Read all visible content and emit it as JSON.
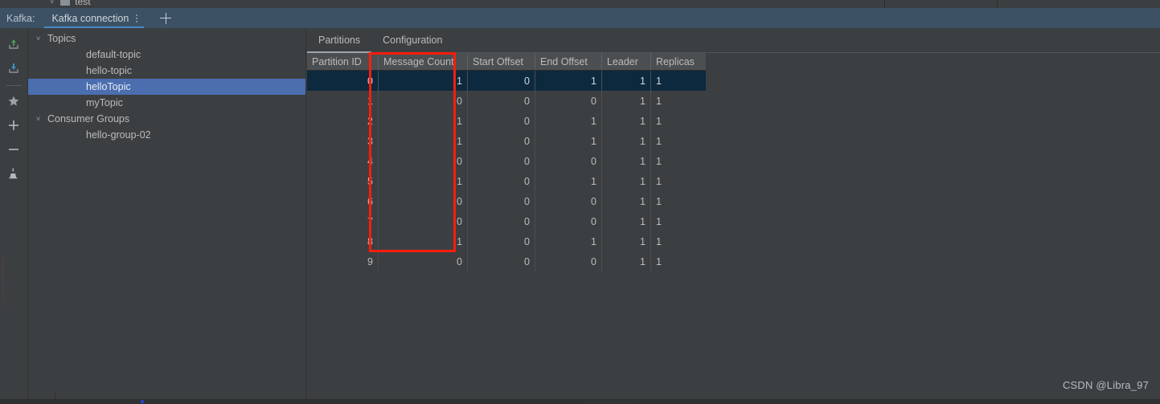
{
  "top_strip": {
    "label": "test",
    "chevron_icon": "chevron-down-icon",
    "folder_icon": "folder-icon"
  },
  "tabbar": {
    "prefix": "Kafka:",
    "tabs": [
      {
        "label": "Kafka connection",
        "active": true,
        "menu_icon": "more-vertical-icon"
      }
    ],
    "add_label": "+",
    "add_icon": "plus-icon",
    "background": "#3c5264",
    "active_underline": "#4a88c7"
  },
  "rail": {
    "buttons": [
      {
        "name": "import-icon",
        "title": "Import"
      },
      {
        "name": "export-icon",
        "title": "Export"
      },
      {
        "name": "favorite-star-icon",
        "title": "Favorite"
      },
      {
        "name": "add-icon",
        "title": "Add"
      },
      {
        "name": "remove-icon",
        "title": "Remove"
      },
      {
        "name": "data-source-icon",
        "title": "Data Source"
      }
    ]
  },
  "tree": {
    "rows": [
      {
        "label": "Topics",
        "level": 0,
        "expanded": true,
        "chevron": "˅",
        "selected": false
      },
      {
        "label": "default-topic",
        "level": 1,
        "expanded": false,
        "chevron": "",
        "selected": false
      },
      {
        "label": "hello-topic",
        "level": 1,
        "expanded": false,
        "chevron": "",
        "selected": false
      },
      {
        "label": "helloTopic",
        "level": 1,
        "expanded": false,
        "chevron": "",
        "selected": true
      },
      {
        "label": "myTopic",
        "level": 1,
        "expanded": false,
        "chevron": "",
        "selected": false
      },
      {
        "label": "Consumer Groups",
        "level": 0,
        "expanded": true,
        "chevron": "˅",
        "selected": false
      },
      {
        "label": "hello-group-02",
        "level": 1,
        "expanded": false,
        "chevron": "",
        "selected": false
      }
    ],
    "selection_color": "#4b6eaf"
  },
  "main": {
    "tabs": [
      {
        "label": "Partitions",
        "active": true
      },
      {
        "label": "Configuration",
        "active": false
      }
    ],
    "table": {
      "columns": [
        "Partition ID",
        "Message Count",
        "Start Offset",
        "End Offset",
        "Leader",
        "Replicas"
      ],
      "rows": [
        {
          "partition_id": "0",
          "message_count": "1",
          "start_offset": "0",
          "end_offset": "1",
          "leader": "1",
          "replicas": "1",
          "selected": true
        },
        {
          "partition_id": "1",
          "message_count": "0",
          "start_offset": "0",
          "end_offset": "0",
          "leader": "1",
          "replicas": "1",
          "selected": false
        },
        {
          "partition_id": "2",
          "message_count": "1",
          "start_offset": "0",
          "end_offset": "1",
          "leader": "1",
          "replicas": "1",
          "selected": false
        },
        {
          "partition_id": "3",
          "message_count": "1",
          "start_offset": "0",
          "end_offset": "1",
          "leader": "1",
          "replicas": "1",
          "selected": false
        },
        {
          "partition_id": "4",
          "message_count": "0",
          "start_offset": "0",
          "end_offset": "0",
          "leader": "1",
          "replicas": "1",
          "selected": false
        },
        {
          "partition_id": "5",
          "message_count": "1",
          "start_offset": "0",
          "end_offset": "1",
          "leader": "1",
          "replicas": "1",
          "selected": false
        },
        {
          "partition_id": "6",
          "message_count": "0",
          "start_offset": "0",
          "end_offset": "0",
          "leader": "1",
          "replicas": "1",
          "selected": false
        },
        {
          "partition_id": "7",
          "message_count": "0",
          "start_offset": "0",
          "end_offset": "0",
          "leader": "1",
          "replicas": "1",
          "selected": false
        },
        {
          "partition_id": "8",
          "message_count": "1",
          "start_offset": "0",
          "end_offset": "1",
          "leader": "1",
          "replicas": "1",
          "selected": false
        },
        {
          "partition_id": "9",
          "message_count": "0",
          "start_offset": "0",
          "end_offset": "0",
          "leader": "1",
          "replicas": "1",
          "selected": false
        }
      ],
      "selected_row_color": "#0d293e",
      "header_color": "#4b4f51"
    },
    "annotation": {
      "shape": "rectangle",
      "color": "#fc1d0c",
      "highlights_column": "Message Count",
      "covers_rows": "0-8"
    }
  },
  "watermark": {
    "text": "CSDN @Libra_97"
  }
}
